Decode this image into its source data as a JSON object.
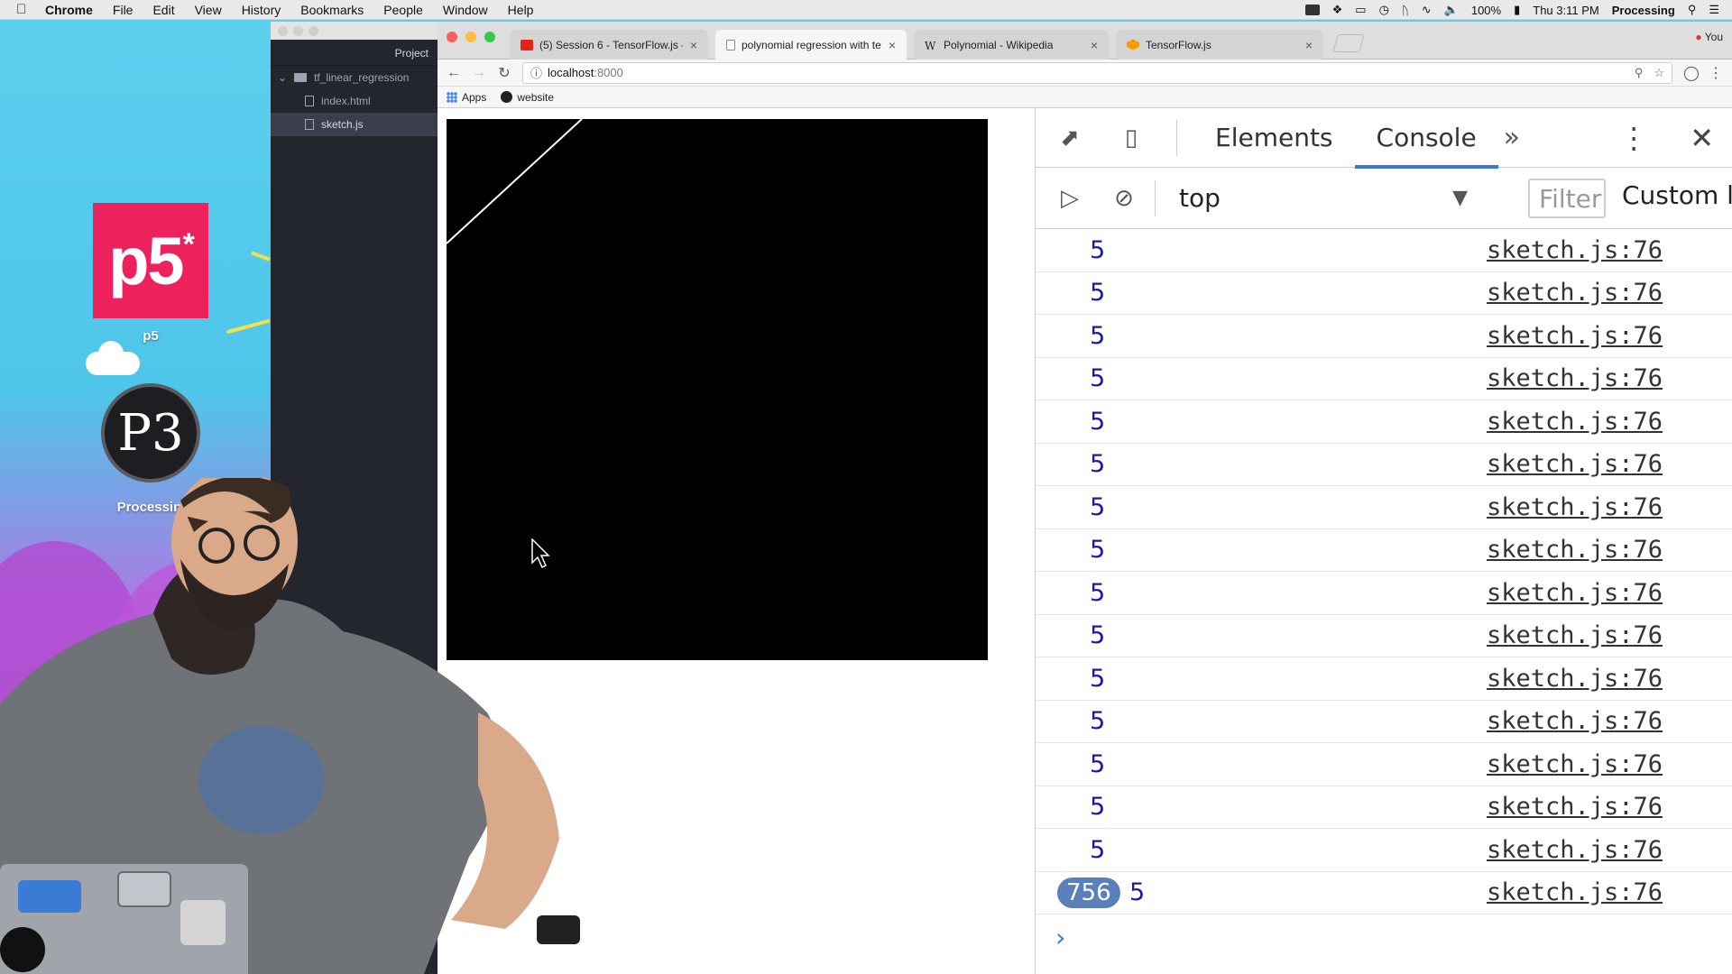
{
  "menubar": {
    "app": "Chrome",
    "items": [
      "File",
      "Edit",
      "View",
      "History",
      "Bookmarks",
      "People",
      "Window",
      "Help"
    ],
    "battery": "100%",
    "clock": "Thu 3:11 PM",
    "active_app": "Processing"
  },
  "desktop": {
    "icons": [
      {
        "label": "p5",
        "logo_text": "p5",
        "logo_mark": "*"
      },
      {
        "label": "Processing",
        "logo_text": "P3"
      }
    ]
  },
  "editor": {
    "header": "Project",
    "folder": "tf_linear_regression",
    "files": [
      "index.html",
      "sketch.js"
    ],
    "selected_file": "sketch.js"
  },
  "browser": {
    "tabs": [
      {
        "title": "(5) Session 6 - TensorFlow.js -",
        "favicon_color": "#e62117",
        "active": false
      },
      {
        "title": "polynomial regression with ten",
        "favicon_color": "#888888",
        "active": true
      },
      {
        "title": "Polynomial - Wikipedia",
        "favicon_color": "#444444",
        "active": false
      },
      {
        "title": "TensorFlow.js",
        "favicon_color": "#f59b00",
        "active": false
      }
    ],
    "user": "You",
    "url_host": "localhost",
    "url_port": ":8000",
    "bookmarks": [
      "Apps",
      "website"
    ]
  },
  "canvas": {
    "background": "#000000",
    "line_color": "#ffffff"
  },
  "devtools": {
    "tabs": [
      "Elements",
      "Console"
    ],
    "active_tab": "Console",
    "context": "top",
    "filter_placeholder": "Filter",
    "levels_label": "Custom l",
    "logs": [
      {
        "value": "5",
        "source": "sketch.js:76"
      },
      {
        "value": "5",
        "source": "sketch.js:76"
      },
      {
        "value": "5",
        "source": "sketch.js:76"
      },
      {
        "value": "5",
        "source": "sketch.js:76"
      },
      {
        "value": "5",
        "source": "sketch.js:76"
      },
      {
        "value": "5",
        "source": "sketch.js:76"
      },
      {
        "value": "5",
        "source": "sketch.js:76"
      },
      {
        "value": "5",
        "source": "sketch.js:76"
      },
      {
        "value": "5",
        "source": "sketch.js:76"
      },
      {
        "value": "5",
        "source": "sketch.js:76"
      },
      {
        "value": "5",
        "source": "sketch.js:76"
      },
      {
        "value": "5",
        "source": "sketch.js:76"
      },
      {
        "value": "5",
        "source": "sketch.js:76"
      },
      {
        "value": "5",
        "source": "sketch.js:76"
      },
      {
        "value": "5",
        "source": "sketch.js:76"
      }
    ],
    "repeated": {
      "count": "756",
      "value": "5",
      "source": "sketch.js:76"
    },
    "prompt": "›"
  }
}
